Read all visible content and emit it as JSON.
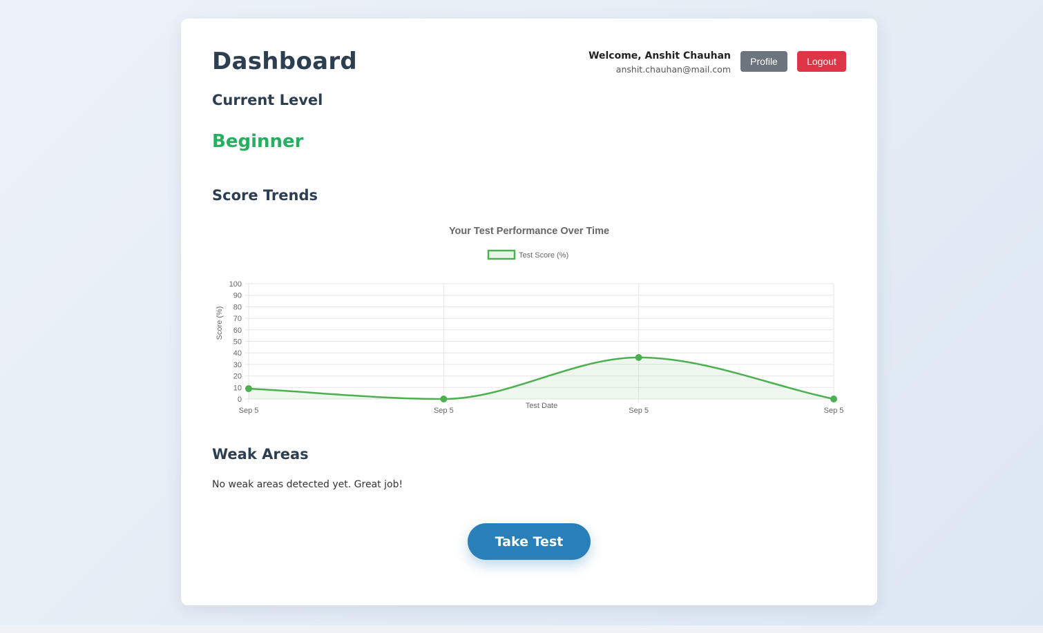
{
  "header": {
    "title": "Dashboard",
    "welcome": "Welcome, Anshit Chauhan",
    "email": "anshit.chauhan@mail.com",
    "profile_label": "Profile",
    "logout_label": "Logout"
  },
  "level": {
    "heading": "Current Level",
    "value": "Beginner"
  },
  "trends": {
    "heading": "Score Trends"
  },
  "weak": {
    "heading": "Weak Areas",
    "message": "No weak areas detected yet. Great job!"
  },
  "actions": {
    "take_test_label": "Take Test"
  },
  "colors": {
    "primary": "#2980b9",
    "level": "#27ae60",
    "series": "#4caf50",
    "profile": "#6c757d",
    "logout": "#dc3545"
  },
  "chart_data": {
    "type": "line",
    "title": "Your Test Performance Over Time",
    "xlabel": "Test Date",
    "ylabel": "Score (%)",
    "categories": [
      "Sep 5",
      "Sep 5",
      "Sep 5",
      "Sep 5"
    ],
    "series": [
      {
        "name": "Test Score (%)",
        "values": [
          9,
          0,
          36,
          0
        ],
        "color": "#4caf50",
        "fill": true
      }
    ],
    "ylim": [
      0,
      100
    ],
    "yticks": [
      0,
      10,
      20,
      30,
      40,
      50,
      60,
      70,
      80,
      90,
      100
    ],
    "grid": true,
    "legend": "top-center",
    "smooth": true
  }
}
